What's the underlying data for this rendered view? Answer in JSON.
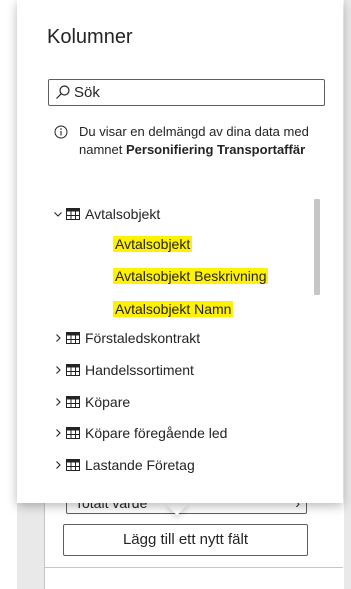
{
  "popup": {
    "title": "Kolumner",
    "search": {
      "placeholder": "Sök"
    },
    "info": {
      "text": "Du visar en delmängd av dina data med namnet ",
      "dataset_name": "Personifiering Transportaffär"
    },
    "tables": [
      {
        "name": "Avtalsobjekt",
        "expanded": true,
        "fields": [
          "Avtalsobjekt",
          "Avtalsobjekt Beskrivning",
          "Avtalsobjekt Namn"
        ]
      },
      {
        "name": "Förstaledskontrakt",
        "expanded": false
      },
      {
        "name": "Handelssortiment",
        "expanded": false
      },
      {
        "name": "Köpare",
        "expanded": false
      },
      {
        "name": "Köpare föregående led",
        "expanded": false
      },
      {
        "name": "Lastande Företag",
        "expanded": false
      }
    ]
  },
  "background": {
    "field_label": "Totalt värde",
    "field_more": "···",
    "add_field_button": "Lägg till ett nytt fält"
  },
  "colors": {
    "highlight": "#fff200",
    "text": "#252423",
    "border": "#605e5c"
  }
}
